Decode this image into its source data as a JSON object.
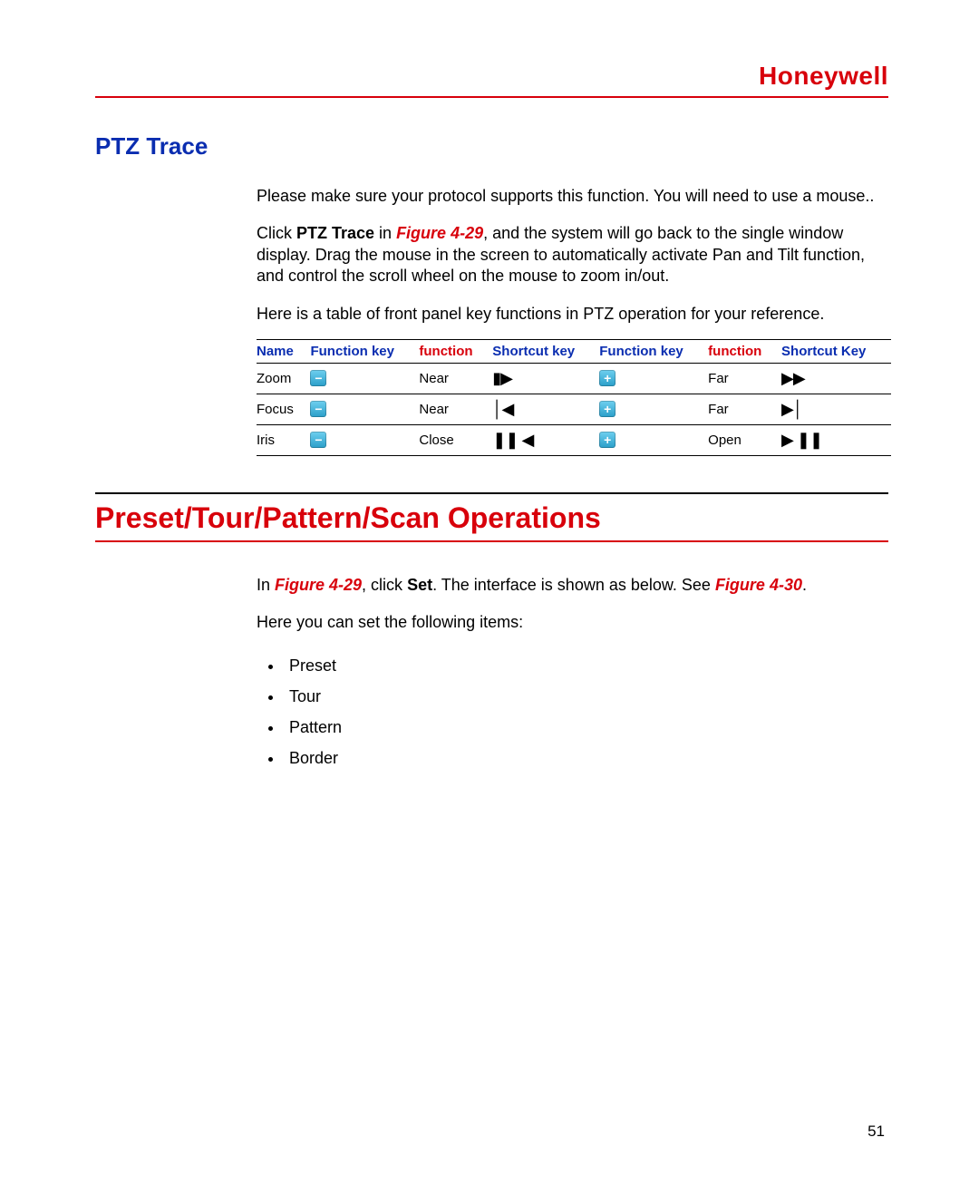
{
  "header": {
    "brand": "Honeywell"
  },
  "ptz": {
    "title": "PTZ Trace",
    "p1": "Please make sure your protocol supports this function. You will need to use a mouse..",
    "p2_pre": "Click ",
    "p2_bold": "PTZ Trace",
    "p2_mid": " in ",
    "p2_fig": "Figure 4-29",
    "p2_post": ", and the system will go back to the single window display. Drag the mouse in the screen to automatically activate Pan and Tilt function, and control the scroll wheel on the mouse to zoom in/out.",
    "p3": "Here is a table of front panel key functions in PTZ operation for your reference."
  },
  "table": {
    "headers": [
      "Name",
      "Function key",
      "function",
      "Shortcut key",
      "Function key",
      "function",
      "Shortcut Key"
    ],
    "rows": [
      {
        "name": "Zoom",
        "fk1": "minus",
        "fn1": "Near",
        "sc1": "▮▶",
        "fk2": "plus",
        "fn2": "Far",
        "sc2": "▶▶"
      },
      {
        "name": "Focus",
        "fk1": "minus",
        "fn1": "Near",
        "sc1": "│◀",
        "fk2": "plus",
        "fn2": "Far",
        "sc2": "▶│"
      },
      {
        "name": "Iris",
        "fk1": "minus",
        "fn1": "Close",
        "sc1": "❚❚ ◀",
        "fk2": "plus",
        "fn2": "Open",
        "sc2": "▶ ❚❚"
      }
    ]
  },
  "ops": {
    "title": "Preset/Tour/Pattern/Scan Operations",
    "p1_pre": "In ",
    "p1_fig1": "Figure 4-29",
    "p1_mid1": ", click ",
    "p1_bold": "Set",
    "p1_mid2": ". The interface is shown as below. See ",
    "p1_fig2": "Figure 4-30",
    "p1_post": ".",
    "p2": "Here you can set the following items:",
    "items": [
      "Preset",
      "Tour",
      "Pattern",
      "Border"
    ]
  },
  "page_number": "51"
}
